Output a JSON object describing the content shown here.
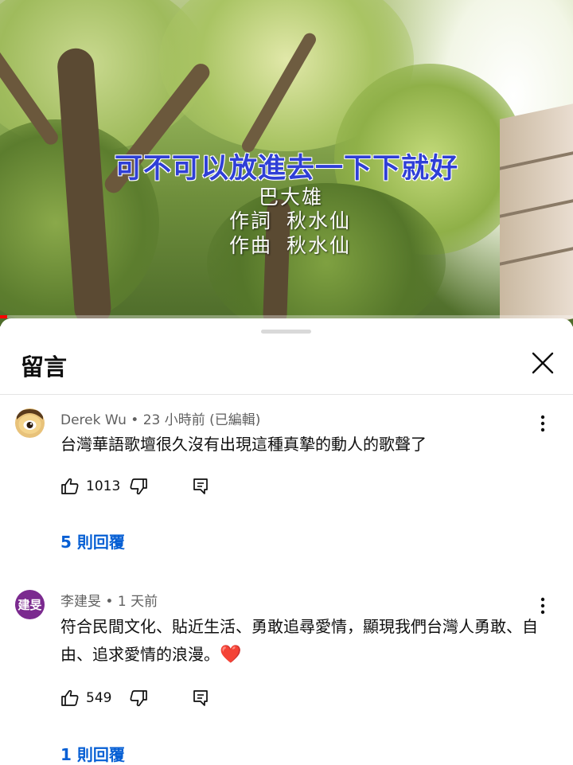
{
  "video": {
    "lyric": "可不可以放進去一下下就好",
    "artist": "巴大雄",
    "lyricist_label": "作詞",
    "lyricist": "秋水仙",
    "composer_label": "作曲",
    "composer": "秋水仙",
    "progress_fraction": 0.012
  },
  "sheet": {
    "title": "留言"
  },
  "comments": [
    {
      "author": "Derek Wu",
      "time": "23 小時前 (已編輯)",
      "text": "台灣華語歌壇很久沒有出現這種真摯的動人的歌聲了",
      "likes": "1013",
      "replies": "5 則回覆",
      "avatar_icon": "photo-avatar"
    },
    {
      "author": "李建旻",
      "time": "1 天前",
      "text": "符合民間文化、貼近生活、勇敢追尋愛情，顯現我們台灣人勇敢、自由、追求愛情的浪漫。",
      "emoji": "❤️",
      "likes": "549",
      "replies": "1 則回覆",
      "avatar_text": "建旻",
      "avatar_color": "#7b2a8f"
    }
  ],
  "colors": {
    "accent_link": "#065fd4",
    "progress": "#ff0000"
  }
}
